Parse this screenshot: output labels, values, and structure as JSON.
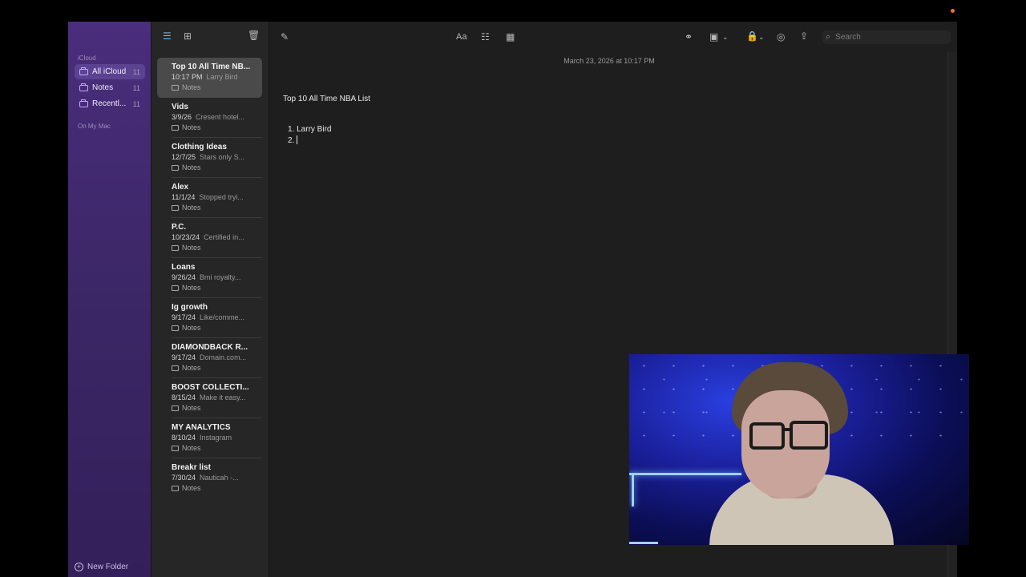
{
  "sidebar": {
    "section_icloud": "iCloud",
    "section_mac": "On My Mac",
    "items": [
      {
        "label": "All iCloud",
        "count": "11"
      },
      {
        "label": "Notes",
        "count": "11"
      },
      {
        "label": "Recentl...",
        "count": "11"
      }
    ],
    "new_folder": "New Folder"
  },
  "notes": [
    {
      "title": "Top 10 All Time NB...",
      "date": "10:17 PM",
      "preview": "Larry Bird",
      "folder": "Notes"
    },
    {
      "title": "Vids",
      "date": "3/9/26",
      "preview": "Cresent hotel...",
      "folder": "Notes"
    },
    {
      "title": "Clothing Ideas",
      "date": "12/7/25",
      "preview": "Stars only S...",
      "folder": "Notes"
    },
    {
      "title": "Alex",
      "date": "11/1/24",
      "preview": "Stopped tryi...",
      "folder": "Notes"
    },
    {
      "title": "P.C.",
      "date": "10/23/24",
      "preview": "Certified in...",
      "folder": "Notes"
    },
    {
      "title": "Loans",
      "date": "9/26/24",
      "preview": "Bmi royalty...",
      "folder": "Notes"
    },
    {
      "title": "Ig growth",
      "date": "9/17/24",
      "preview": "Like/comme...",
      "folder": "Notes"
    },
    {
      "title": "DIAMONDBACK R...",
      "date": "9/17/24",
      "preview": "Domain.com...",
      "folder": "Notes"
    },
    {
      "title": "BOOST COLLECTI...",
      "date": "8/15/24",
      "preview": "Make it easy...",
      "folder": "Notes"
    },
    {
      "title": "MY ANALYTICS",
      "date": "8/10/24",
      "preview": "Instagram",
      "folder": "Notes"
    },
    {
      "title": "Breakr list",
      "date": "7/30/24",
      "preview": "Nauticah -...",
      "folder": "Notes"
    }
  ],
  "editor": {
    "date": "March 23, 2026 at 10:17 PM",
    "title": "Top 10 All Time NBA List",
    "line1_num": "1.",
    "line1_text": "Larry Bird",
    "line2_num": "2."
  },
  "toolbar": {
    "format_label": "Aa",
    "search_placeholder": "Search"
  }
}
